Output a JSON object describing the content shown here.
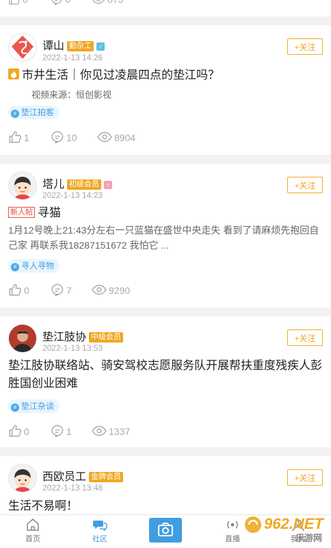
{
  "top_stats": {
    "likes": "0",
    "comments": "0",
    "views": "873"
  },
  "posts": [
    {
      "author": "谭山",
      "badge": "勤杂工",
      "gender": "male",
      "date": "2022-1-13 14:26",
      "follow": "+关注",
      "title": "市井生活｜你见过凌晨四点的垫江吗？",
      "subtitle": "视频来源：恒创影视",
      "tag": "垫江拍客",
      "likes": "1",
      "comments": "10",
      "views": "8904"
    },
    {
      "author": "塔儿",
      "badge": "初级会员",
      "gender": "female",
      "date": "2022-1-13 14:23",
      "follow": "+关注",
      "new_label": "新人帖",
      "title": "寻猫",
      "body": "1月12号晚上21:43分左右一只蓝猫在盛世中央走失 看到了请麻烦先抱回自己家 再联系我18287151672 我怕它 ...",
      "tag": "寻人寻物",
      "likes": "0",
      "comments": "7",
      "views": "9290"
    },
    {
      "author": "垫江肢协",
      "badge": "中级会员",
      "date": "2022-1-13 13:53",
      "follow": "+关注",
      "title": "垫江肢协联络站、骑安驾校志愿服务队开展帮扶重度残疾人彭胜国创业困难",
      "tag": "垫江杂谈",
      "likes": "0",
      "comments": "1",
      "views": "1337"
    },
    {
      "author": "西欧员工",
      "badge": "金牌会员",
      "date": "2022-1-13 13:48",
      "follow": "+关注",
      "title": "生活不易啊！"
    }
  ],
  "tabbar": {
    "home": "首页",
    "community": "社区",
    "live": "直播",
    "mine": "我的"
  },
  "watermark": {
    "brand": "962.NET",
    "sub": "乐游网"
  },
  "colors": {
    "accent": "#f0a722",
    "blue": "#3e9ee0",
    "male": "#5bc0eb",
    "female": "#f59fb3"
  }
}
